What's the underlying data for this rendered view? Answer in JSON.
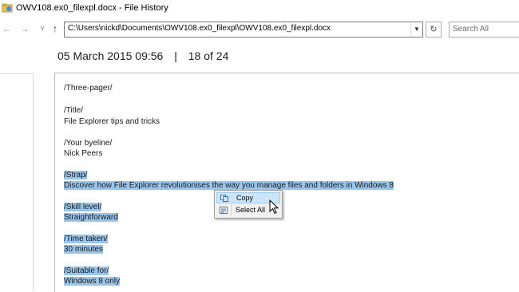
{
  "window": {
    "title": "OWV108.ex0_filexpl.docx - File History"
  },
  "toolbar": {
    "back_icon": "back-arrow-icon",
    "forward_icon": "forward-arrow-icon",
    "up_icon": "up-arrow-icon",
    "address": "C:\\Users\\nickd\\Documents\\OWV108.ex0_filexpl\\OWV108.ex0_filexpl.docx",
    "search_placeholder": "Search All"
  },
  "version": {
    "date": "05 March 2015 09:56",
    "separator": "|",
    "position": "18 of 24"
  },
  "document": {
    "lines": [
      {
        "text": "/Three-pager/",
        "highlight": false
      },
      {
        "text": "/Title/",
        "highlight": false
      },
      {
        "text": "File Explorer tips and tricks",
        "highlight": false
      },
      {
        "text": "/Your byeline/",
        "highlight": false
      },
      {
        "text": "Nick Peers",
        "highlight": false
      },
      {
        "text": "/Strap/",
        "highlight": true
      },
      {
        "text": "Discover how File Explorer revolutionises the way you manage files and folders in Windows 8",
        "highlight": true
      },
      {
        "text": "/Skill level/",
        "highlight": true
      },
      {
        "text": "Straightforward",
        "highlight": true
      },
      {
        "text": "/Time taken/",
        "highlight": true
      },
      {
        "text": "30 minutes",
        "highlight": true
      },
      {
        "text": "/Suitable for/",
        "highlight": true
      },
      {
        "text": "Windows 8 only",
        "highlight": true
      }
    ]
  },
  "context_menu": {
    "items": [
      {
        "label": "Copy",
        "icon": "copy-icon",
        "active": true
      },
      {
        "label": "Select All",
        "icon": "select-all-icon",
        "active": false
      }
    ]
  },
  "colors": {
    "selection": "#99c5ec",
    "menu_hover": "#cde6f7"
  }
}
